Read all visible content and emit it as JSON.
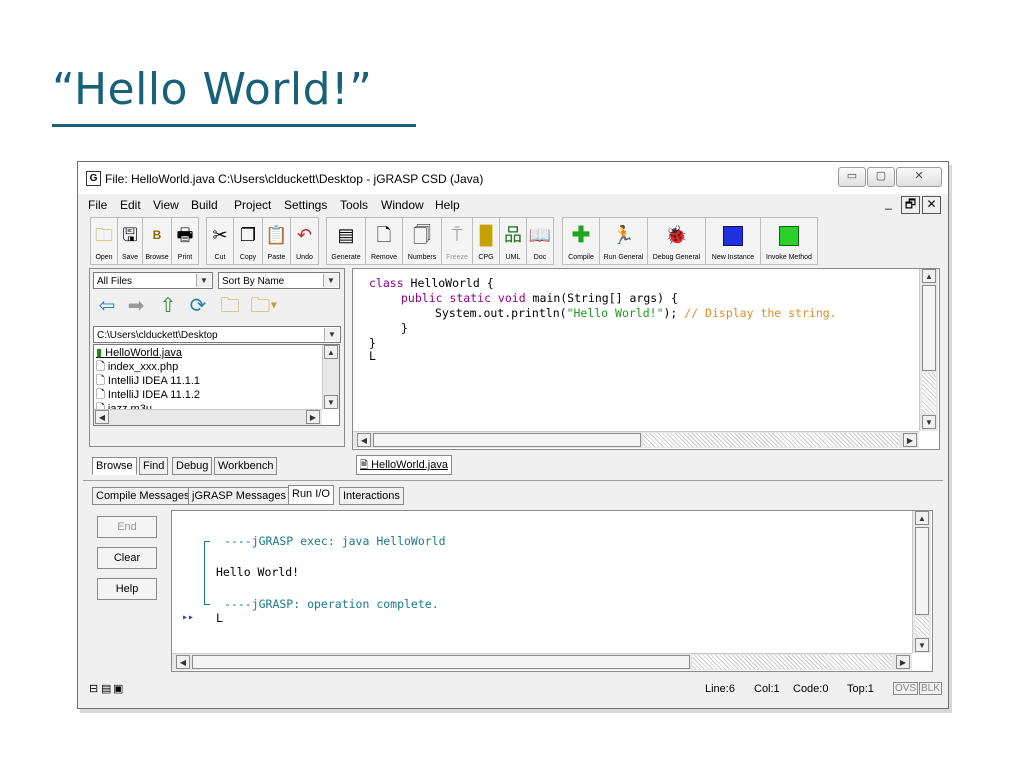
{
  "slide": {
    "title": "“Hello World!”"
  },
  "window": {
    "title": "File: HelloWorld.java  C:\\Users\\clduckett\\Desktop - jGRASP CSD (Java)",
    "app_icon": "G",
    "controls": {
      "minimize": "▭",
      "restore": "▢",
      "close": "✕"
    },
    "mdi_controls": {
      "minimize": "_",
      "restore": "🗗",
      "close": "✕"
    }
  },
  "menubar": [
    "File",
    "Edit",
    "View",
    "Build",
    "Project",
    "Settings",
    "Tools",
    "Window",
    "Help"
  ],
  "toolbar": [
    {
      "label": "Open",
      "icon": "folder-icon"
    },
    {
      "label": "Save",
      "icon": "floppy-icon"
    },
    {
      "label": "Browse",
      "icon": "browse-icon"
    },
    {
      "label": "Print",
      "icon": "printer-icon"
    },
    {
      "label": "Cut",
      "icon": "scissors-icon"
    },
    {
      "label": "Copy",
      "icon": "copy-icon"
    },
    {
      "label": "Paste",
      "icon": "paste-icon"
    },
    {
      "label": "Undo",
      "icon": "undo-icon"
    },
    {
      "label": "Generate",
      "icon": "generate-icon"
    },
    {
      "label": "Remove",
      "icon": "remove-icon"
    },
    {
      "label": "Numbers",
      "icon": "numbers-icon"
    },
    {
      "label": "Freeze",
      "icon": "pin-icon"
    },
    {
      "label": "CPG",
      "icon": "cpg-icon"
    },
    {
      "label": "UML",
      "icon": "uml-icon"
    },
    {
      "label": "Doc",
      "icon": "book-icon"
    },
    {
      "label": "Compile",
      "icon": "plus-icon"
    },
    {
      "label": "Run General",
      "icon": "runner-icon"
    },
    {
      "label": "Debug General",
      "icon": "bug-icon"
    },
    {
      "label": "New Instance",
      "icon": "blue-square-icon"
    },
    {
      "label": "Invoke Method",
      "icon": "green-square-icon"
    }
  ],
  "browser": {
    "filter": "All Files",
    "sort": "Sort By Name",
    "path": "C:\\Users\\clduckett\\Desktop",
    "files": [
      "HelloWorld.java",
      "index_xxx.php",
      "IntelliJ IDEA 11.1.1",
      "IntelliJ IDEA 11.1.2",
      "jazz.m3u"
    ],
    "tabs": [
      "Browse",
      "Find",
      "Debug",
      "Workbench"
    ]
  },
  "editor": {
    "code": {
      "l1_kw": "class",
      "l1_rest": " HelloWorld {",
      "l2_kw": "public static void",
      "l2_rest": " main(String[] args) {",
      "l3_a": "System.out.println(",
      "l3_str": "\"Hello World!\"",
      "l3_b": "); ",
      "l3_cmt": "// Display the string.",
      "l4": "}",
      "l5": "}",
      "l6": "L"
    },
    "file_tab": "HelloWorld.java"
  },
  "messages": {
    "tabs": [
      "Compile Messages",
      "jGRASP Messages",
      "Run I/O",
      "Interactions"
    ],
    "buttons": {
      "end": "End",
      "clear": "Clear",
      "help": "Help"
    },
    "console": {
      "line1": "----jGRASP exec: java HelloWorld",
      "line2": "Hello World!",
      "line3": "----jGRASP: operation complete.",
      "prompt": "▸▸",
      "cursor": "L"
    }
  },
  "status": {
    "line": "Line:6",
    "col": "Col:1",
    "code": "Code:0",
    "top": "Top:1",
    "ovs": "OVS",
    "blk": "BLK"
  },
  "colors": {
    "title": "#17627a",
    "keyword": "#8b008b",
    "string": "#1a9a1a",
    "comment": "#e58b26",
    "console": "#1a7a8a"
  }
}
